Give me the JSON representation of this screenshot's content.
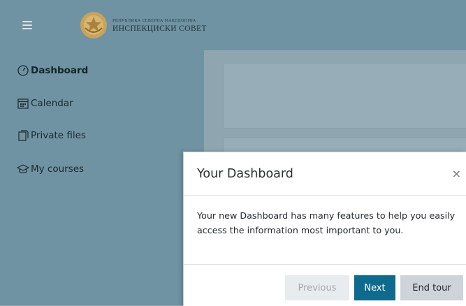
{
  "header": {
    "org_small": "РЕПУБЛИКА СЕВЕРНА МАКЕДОНИЈА",
    "org_name": "ИНСПЕКЦИСКИ СОВЕТ"
  },
  "sidebar": {
    "items": [
      {
        "label": "Dashboard",
        "icon": "dashboard-gauge-icon",
        "active": true
      },
      {
        "label": "Calendar",
        "icon": "calendar-icon",
        "active": false
      },
      {
        "label": "Private files",
        "icon": "file-icon",
        "active": false
      },
      {
        "label": "My courses",
        "icon": "graduation-cap-icon",
        "active": false
      }
    ]
  },
  "tour_dialog": {
    "title": "Your Dashboard",
    "close_glyph": "×",
    "body": "Your new Dashboard has many features to help you easily access the information most important to you.",
    "buttons": {
      "previous": "Previous",
      "next": "Next",
      "end": "End tour"
    }
  },
  "colors": {
    "header_bg": "#6f93a3",
    "sidebar_bg": "#6f93a3",
    "backdrop": "#8fa6b1",
    "next_button": "#0f6b8e"
  }
}
